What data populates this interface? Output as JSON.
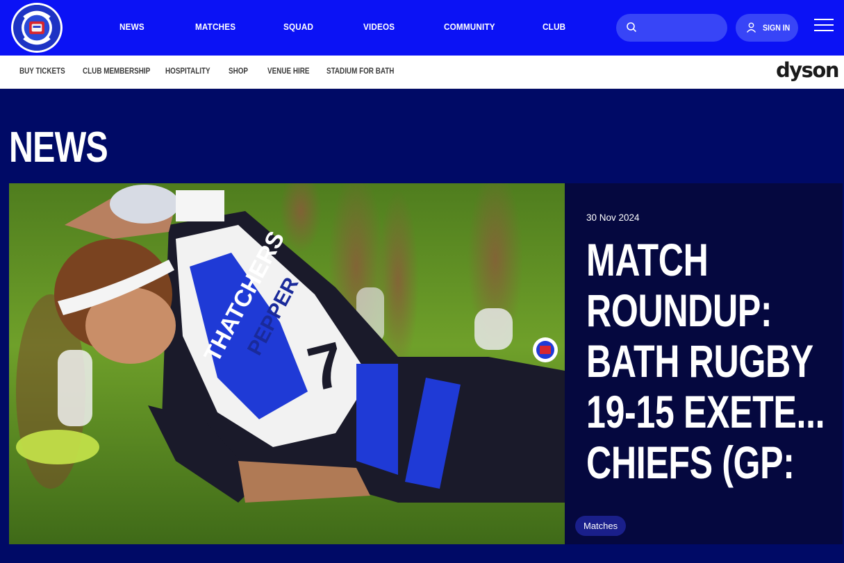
{
  "header": {
    "logo_alt": "Bath Rugby",
    "nav": [
      "NEWS",
      "MATCHES",
      "SQUAD",
      "VIDEOS",
      "COMMUNITY",
      "CLUB"
    ],
    "search": {
      "placeholder": "",
      "icon": "search-icon"
    },
    "signin_label": "SIGN IN",
    "menu_icon": "hamburger-menu-icon"
  },
  "subnav": {
    "items": [
      "BUY TICKETS",
      "CLUB MEMBERSHIP",
      "HOSPITALITY",
      "SHOP",
      "VENUE HIRE",
      "STADIUM FOR BATH"
    ],
    "sponsor": "dyson"
  },
  "page": {
    "title": "NEWS"
  },
  "featured": {
    "date": "30 Nov 2024",
    "headline_lines": [
      "MATCH",
      "ROUNDUP:",
      "BATH RUGBY",
      "19-15 EXETE...",
      "CHIEFS (GP:"
    ],
    "tag": "Matches"
  },
  "colors": {
    "header_bg": "#0b12f5",
    "page_bg": "#000a66",
    "card_bg": "#05083f",
    "tag_bg": "#1a1f8a"
  }
}
